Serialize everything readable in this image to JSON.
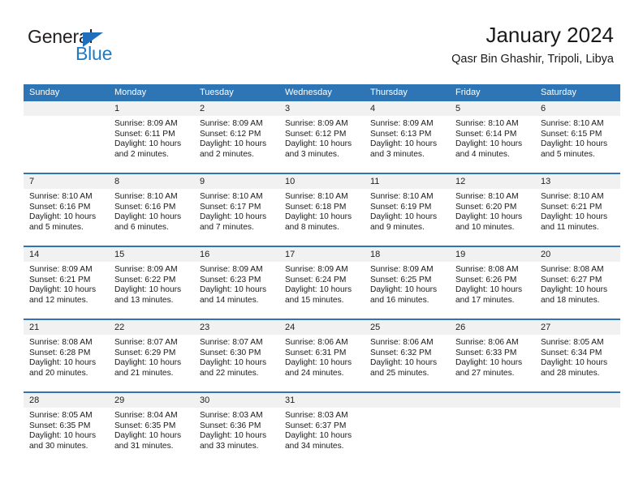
{
  "brand": {
    "name_part1": "General",
    "name_part2": "Blue",
    "triangle_color": "#1f6fbc",
    "blue_color": "#1f7ac4"
  },
  "header": {
    "title": "January 2024",
    "subtitle": "Qasr Bin Ghashir, Tripoli, Libya"
  },
  "theme": {
    "header_blue": "#2e75b6",
    "daynum_gray": "#f1f1f1",
    "text": "#1a1a1a"
  },
  "columns": [
    "Sunday",
    "Monday",
    "Tuesday",
    "Wednesday",
    "Thursday",
    "Friday",
    "Saturday"
  ],
  "weeks": [
    [
      {
        "day": "",
        "sunrise": "",
        "sunset": "",
        "daylight1": "",
        "daylight2": ""
      },
      {
        "day": "1",
        "sunrise": "Sunrise: 8:09 AM",
        "sunset": "Sunset: 6:11 PM",
        "daylight1": "Daylight: 10 hours",
        "daylight2": "and 2 minutes."
      },
      {
        "day": "2",
        "sunrise": "Sunrise: 8:09 AM",
        "sunset": "Sunset: 6:12 PM",
        "daylight1": "Daylight: 10 hours",
        "daylight2": "and 2 minutes."
      },
      {
        "day": "3",
        "sunrise": "Sunrise: 8:09 AM",
        "sunset": "Sunset: 6:12 PM",
        "daylight1": "Daylight: 10 hours",
        "daylight2": "and 3 minutes."
      },
      {
        "day": "4",
        "sunrise": "Sunrise: 8:09 AM",
        "sunset": "Sunset: 6:13 PM",
        "daylight1": "Daylight: 10 hours",
        "daylight2": "and 3 minutes."
      },
      {
        "day": "5",
        "sunrise": "Sunrise: 8:10 AM",
        "sunset": "Sunset: 6:14 PM",
        "daylight1": "Daylight: 10 hours",
        "daylight2": "and 4 minutes."
      },
      {
        "day": "6",
        "sunrise": "Sunrise: 8:10 AM",
        "sunset": "Sunset: 6:15 PM",
        "daylight1": "Daylight: 10 hours",
        "daylight2": "and 5 minutes."
      }
    ],
    [
      {
        "day": "7",
        "sunrise": "Sunrise: 8:10 AM",
        "sunset": "Sunset: 6:16 PM",
        "daylight1": "Daylight: 10 hours",
        "daylight2": "and 5 minutes."
      },
      {
        "day": "8",
        "sunrise": "Sunrise: 8:10 AM",
        "sunset": "Sunset: 6:16 PM",
        "daylight1": "Daylight: 10 hours",
        "daylight2": "and 6 minutes."
      },
      {
        "day": "9",
        "sunrise": "Sunrise: 8:10 AM",
        "sunset": "Sunset: 6:17 PM",
        "daylight1": "Daylight: 10 hours",
        "daylight2": "and 7 minutes."
      },
      {
        "day": "10",
        "sunrise": "Sunrise: 8:10 AM",
        "sunset": "Sunset: 6:18 PM",
        "daylight1": "Daylight: 10 hours",
        "daylight2": "and 8 minutes."
      },
      {
        "day": "11",
        "sunrise": "Sunrise: 8:10 AM",
        "sunset": "Sunset: 6:19 PM",
        "daylight1": "Daylight: 10 hours",
        "daylight2": "and 9 minutes."
      },
      {
        "day": "12",
        "sunrise": "Sunrise: 8:10 AM",
        "sunset": "Sunset: 6:20 PM",
        "daylight1": "Daylight: 10 hours",
        "daylight2": "and 10 minutes."
      },
      {
        "day": "13",
        "sunrise": "Sunrise: 8:10 AM",
        "sunset": "Sunset: 6:21 PM",
        "daylight1": "Daylight: 10 hours",
        "daylight2": "and 11 minutes."
      }
    ],
    [
      {
        "day": "14",
        "sunrise": "Sunrise: 8:09 AM",
        "sunset": "Sunset: 6:21 PM",
        "daylight1": "Daylight: 10 hours",
        "daylight2": "and 12 minutes."
      },
      {
        "day": "15",
        "sunrise": "Sunrise: 8:09 AM",
        "sunset": "Sunset: 6:22 PM",
        "daylight1": "Daylight: 10 hours",
        "daylight2": "and 13 minutes."
      },
      {
        "day": "16",
        "sunrise": "Sunrise: 8:09 AM",
        "sunset": "Sunset: 6:23 PM",
        "daylight1": "Daylight: 10 hours",
        "daylight2": "and 14 minutes."
      },
      {
        "day": "17",
        "sunrise": "Sunrise: 8:09 AM",
        "sunset": "Sunset: 6:24 PM",
        "daylight1": "Daylight: 10 hours",
        "daylight2": "and 15 minutes."
      },
      {
        "day": "18",
        "sunrise": "Sunrise: 8:09 AM",
        "sunset": "Sunset: 6:25 PM",
        "daylight1": "Daylight: 10 hours",
        "daylight2": "and 16 minutes."
      },
      {
        "day": "19",
        "sunrise": "Sunrise: 8:08 AM",
        "sunset": "Sunset: 6:26 PM",
        "daylight1": "Daylight: 10 hours",
        "daylight2": "and 17 minutes."
      },
      {
        "day": "20",
        "sunrise": "Sunrise: 8:08 AM",
        "sunset": "Sunset: 6:27 PM",
        "daylight1": "Daylight: 10 hours",
        "daylight2": "and 18 minutes."
      }
    ],
    [
      {
        "day": "21",
        "sunrise": "Sunrise: 8:08 AM",
        "sunset": "Sunset: 6:28 PM",
        "daylight1": "Daylight: 10 hours",
        "daylight2": "and 20 minutes."
      },
      {
        "day": "22",
        "sunrise": "Sunrise: 8:07 AM",
        "sunset": "Sunset: 6:29 PM",
        "daylight1": "Daylight: 10 hours",
        "daylight2": "and 21 minutes."
      },
      {
        "day": "23",
        "sunrise": "Sunrise: 8:07 AM",
        "sunset": "Sunset: 6:30 PM",
        "daylight1": "Daylight: 10 hours",
        "daylight2": "and 22 minutes."
      },
      {
        "day": "24",
        "sunrise": "Sunrise: 8:06 AM",
        "sunset": "Sunset: 6:31 PM",
        "daylight1": "Daylight: 10 hours",
        "daylight2": "and 24 minutes."
      },
      {
        "day": "25",
        "sunrise": "Sunrise: 8:06 AM",
        "sunset": "Sunset: 6:32 PM",
        "daylight1": "Daylight: 10 hours",
        "daylight2": "and 25 minutes."
      },
      {
        "day": "26",
        "sunrise": "Sunrise: 8:06 AM",
        "sunset": "Sunset: 6:33 PM",
        "daylight1": "Daylight: 10 hours",
        "daylight2": "and 27 minutes."
      },
      {
        "day": "27",
        "sunrise": "Sunrise: 8:05 AM",
        "sunset": "Sunset: 6:34 PM",
        "daylight1": "Daylight: 10 hours",
        "daylight2": "and 28 minutes."
      }
    ],
    [
      {
        "day": "28",
        "sunrise": "Sunrise: 8:05 AM",
        "sunset": "Sunset: 6:35 PM",
        "daylight1": "Daylight: 10 hours",
        "daylight2": "and 30 minutes."
      },
      {
        "day": "29",
        "sunrise": "Sunrise: 8:04 AM",
        "sunset": "Sunset: 6:35 PM",
        "daylight1": "Daylight: 10 hours",
        "daylight2": "and 31 minutes."
      },
      {
        "day": "30",
        "sunrise": "Sunrise: 8:03 AM",
        "sunset": "Sunset: 6:36 PM",
        "daylight1": "Daylight: 10 hours",
        "daylight2": "and 33 minutes."
      },
      {
        "day": "31",
        "sunrise": "Sunrise: 8:03 AM",
        "sunset": "Sunset: 6:37 PM",
        "daylight1": "Daylight: 10 hours",
        "daylight2": "and 34 minutes."
      },
      {
        "day": "",
        "sunrise": "",
        "sunset": "",
        "daylight1": "",
        "daylight2": ""
      },
      {
        "day": "",
        "sunrise": "",
        "sunset": "",
        "daylight1": "",
        "daylight2": ""
      },
      {
        "day": "",
        "sunrise": "",
        "sunset": "",
        "daylight1": "",
        "daylight2": ""
      }
    ]
  ]
}
